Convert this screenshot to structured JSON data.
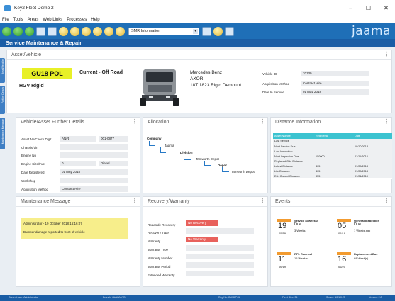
{
  "window": {
    "title": "Key2 Fleet Demo 2",
    "minimize": "–",
    "maximize": "☐",
    "close": "✕"
  },
  "menu": [
    "File",
    "Tools",
    "Areas",
    "Web Links",
    "Processes",
    "Help"
  ],
  "toolbar": {
    "combo_value": "SMR Information",
    "logo": "jaama"
  },
  "header": {
    "title": "Service Maintenance & Repair"
  },
  "vtabs": [
    "Asset/Vehicle",
    "Further Details",
    "Maintenance Message"
  ],
  "asset": {
    "panel_title": "Asset/Vehicle",
    "reg": "GU18 POL",
    "status": "Current - Off Road",
    "type": "HGV Rigid",
    "make": "Mercedes Benz",
    "model": "AXOR",
    "desc": "18T 1823 Rigid Demount",
    "fields": [
      {
        "label": "Vehicle ID",
        "value": "20139"
      },
      {
        "label": "Acquisition Method",
        "value": "Contract Hire"
      },
      {
        "label": "Date In Service",
        "value": "01 May 2018"
      }
    ]
  },
  "further": {
    "title": "Vehicle/Asset Further Details",
    "rows": [
      {
        "label": "Asset No/Check Digit",
        "v1": "AN#b",
        "v2": "001-0877"
      },
      {
        "label": "Chassis/Vin",
        "v1": "",
        "v2": ""
      },
      {
        "label": "Engine No",
        "v1": "",
        "v2": ""
      },
      {
        "label": "Engine Size/Fuel",
        "v1": "0",
        "v2": "Diesel"
      },
      {
        "label": "Date Registered",
        "v1": "01 May 2018",
        "v2": ""
      },
      {
        "label": "Workshop",
        "v1": "",
        "v2": ""
      },
      {
        "label": "Acquisition Method",
        "v1": "Contract Hire",
        "v2": ""
      }
    ]
  },
  "allocation": {
    "title": "Allocation",
    "nodes": [
      "Company",
      "Jaama",
      "Division",
      "Tamworth Depot",
      "Depot",
      "Tamworth Depot"
    ]
  },
  "distance": {
    "title": "Distance Information",
    "headers": [
      "Asset Number",
      "Reg/Serial",
      "Date"
    ],
    "rows": [
      [
        "Last Service",
        "",
        ""
      ],
      [
        "Next Service Due",
        "",
        "10/10/2018"
      ],
      [
        "Last Inspection",
        "",
        ""
      ],
      [
        "Next Inspection Due",
        "150000",
        "01/11/2018"
      ],
      [
        "Replaced Odo Distance",
        "",
        ""
      ],
      [
        "Latest Distance",
        "405",
        "01/09/2018"
      ],
      [
        "Life Distance",
        "405",
        "01/09/2018"
      ],
      [
        "Est. Current Distance",
        "855",
        "01/01/2019"
      ]
    ]
  },
  "maintenance": {
    "title": "Maintenance Message",
    "author_line": "Administrator - 19 October 2018 16:16:07",
    "message": "Bumper damage reported to front of vehicle"
  },
  "recovery": {
    "title": "Recovery/Warranty",
    "rows": [
      {
        "label": "Roadside Recovery",
        "value": "No Recovery",
        "red": true
      },
      {
        "label": "Recovery Type",
        "value": "",
        "red": false
      },
      {
        "label": "Warranty",
        "value": "No Warranty",
        "red": true
      },
      {
        "label": "Warranty Type",
        "value": "",
        "red": false
      },
      {
        "label": "Warranty Number",
        "value": "",
        "red": false
      },
      {
        "label": "Warranty Period",
        "value": "",
        "red": false
      },
      {
        "label": "Extended Warranty",
        "value": "",
        "red": false
      }
    ]
  },
  "events": {
    "title": "Events",
    "items": [
      {
        "day": "19",
        "date": "05/19",
        "title": "Service (3 weeks)",
        "status": "Due",
        "sub": "3 Weeks"
      },
      {
        "day": "05",
        "date": "05/19",
        "title": "General Inspection",
        "status": "Due",
        "sub": "1 Weeks ago"
      },
      {
        "day": "11",
        "date": "06/19",
        "title": "RFL Renewal",
        "status": "",
        "sub": "15 Week(s)"
      },
      {
        "day": "16",
        "date": "06/20",
        "title": "Replacement Due",
        "status": "",
        "sub": "68 Week(s)"
      }
    ]
  },
  "footer": [
    "Current user: Administrator",
    "Branch: JAAMA LTD",
    "Reg No: GU18 POL",
    "Fleet Size: 34",
    "Server: 10.1.0.25",
    "Version: 2.0"
  ],
  "colors": {
    "toolbar": "#1f6fb7",
    "header": "#1a5da5",
    "tag": "#e8f027",
    "teal": "#3cc3d0",
    "orange": "#f29b30",
    "red": "#e8615c"
  }
}
